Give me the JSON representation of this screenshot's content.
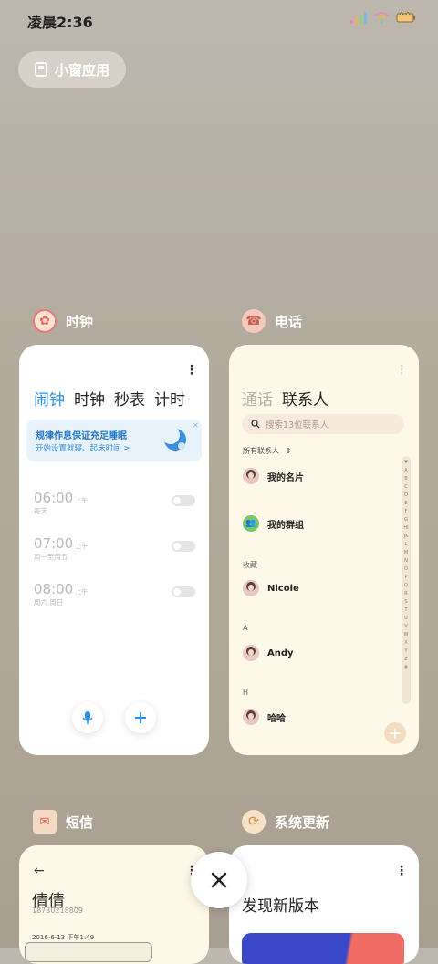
{
  "status_bar": {
    "time": "凌晨2:36"
  },
  "small_window_button": {
    "label": "小窗应用"
  },
  "clock_app": {
    "name": "时钟",
    "tabs": [
      "闹钟",
      "时钟",
      "秒表",
      "计时"
    ],
    "active_tab": "闹钟",
    "banner": {
      "title": "规律作息保证充足睡眠",
      "subtitle": "开始设置就寝、起床时间 >"
    },
    "alarms": [
      {
        "time": "06:00",
        "ampm": "上午",
        "days": "每天",
        "enabled": false
      },
      {
        "time": "07:00",
        "ampm": "上午",
        "days": "周一至周五",
        "enabled": false
      },
      {
        "time": "08:00",
        "ampm": "上午",
        "days": "周六 周日",
        "enabled": false
      }
    ]
  },
  "phone_app": {
    "name": "电话",
    "tabs": [
      "通话",
      "联系人"
    ],
    "active_tab": "联系人",
    "search_placeholder": "搜索13位联系人",
    "filter_label": "所有联系人",
    "contacts": {
      "my_card": "我的名片",
      "my_groups": "我的群组",
      "favorites_header": "收藏",
      "favorite": "Nicole",
      "section_a": "A",
      "contact_a": "Andy",
      "section_h": "H",
      "contact_h": "哈哈"
    },
    "index_letters": "♥ABCDEFGHIJKLMNOPQRSTUVWXYZ#"
  },
  "sms_app": {
    "name": "短信",
    "contact_name": "倩倩",
    "contact_number": "18730218809",
    "message_time": "2016-6-13 下午1:49"
  },
  "update_app": {
    "name": "系统更新",
    "headline": "发现新版本"
  },
  "colors": {
    "accent": "#2c8ee8",
    "group_green": "#7cc46e"
  }
}
